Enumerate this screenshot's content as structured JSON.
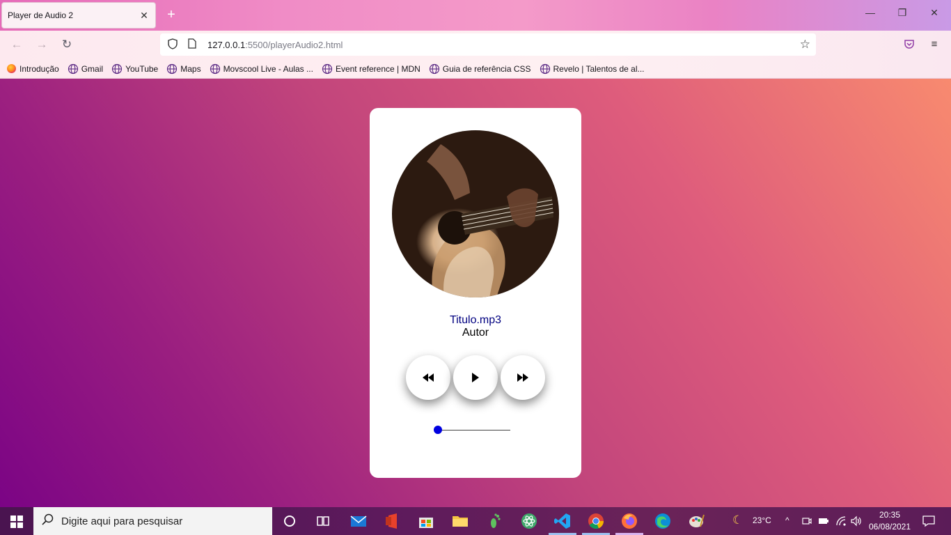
{
  "browser": {
    "tab_title": "Player de Audio 2",
    "url_host": "127.0.0.1",
    "url_rest": ":5500/playerAudio2.html",
    "bookmarks": [
      {
        "label": "Introdução",
        "icon": "firefox-icon"
      },
      {
        "label": "Gmail",
        "icon": "globe-icon"
      },
      {
        "label": "YouTube",
        "icon": "globe-icon"
      },
      {
        "label": "Maps",
        "icon": "globe-icon"
      },
      {
        "label": "Movscool Live - Aulas ...",
        "icon": "globe-icon"
      },
      {
        "label": "Event reference | MDN",
        "icon": "globe-icon"
      },
      {
        "label": "Guia de referência CSS",
        "icon": "globe-icon"
      },
      {
        "label": "Revelo | Talentos de al...",
        "icon": "globe-icon"
      }
    ]
  },
  "player": {
    "title": "Titulo.mp3",
    "author": "Autor",
    "progress": 0.0,
    "accent_color": "#0000e0",
    "buttons": [
      "rewind-icon",
      "play-icon",
      "fast-forward-icon"
    ]
  },
  "taskbar": {
    "search_placeholder": "Digite aqui para pesquisar",
    "weather": "23°C",
    "time": "20:35",
    "date": "06/08/2021"
  }
}
